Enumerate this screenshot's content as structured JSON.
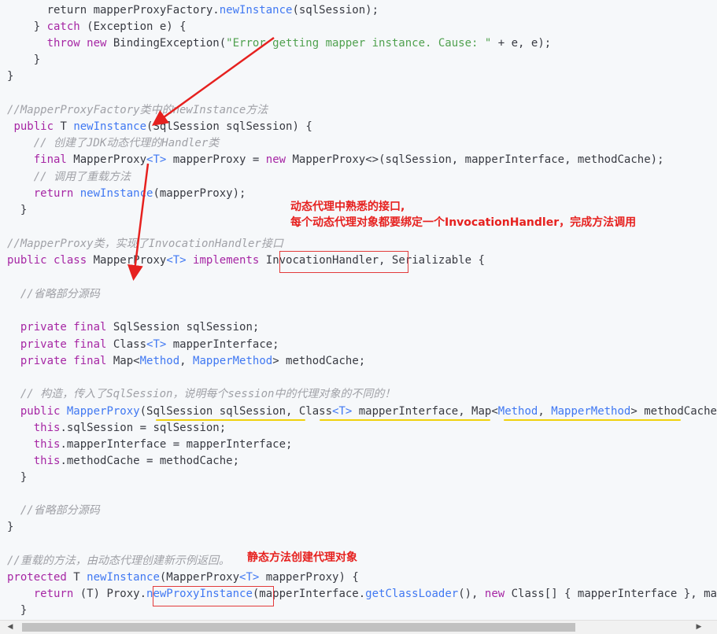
{
  "lines": [
    {
      "id": "l1",
      "segments": [
        [
          "plain",
          "      return mapperProxyFactory."
        ],
        [
          "fn",
          "newInstance"
        ],
        [
          "plain",
          "(sqlSession);"
        ]
      ]
    },
    {
      "id": "l2",
      "segments": [
        [
          "plain",
          "    } "
        ],
        [
          "kw",
          "catch"
        ],
        [
          "plain",
          " (Exception e) {"
        ]
      ]
    },
    {
      "id": "l3",
      "segments": [
        [
          "plain",
          "      "
        ],
        [
          "kw",
          "throw new"
        ],
        [
          "plain",
          " BindingException("
        ],
        [
          "str",
          "\"Error getting mapper instance. Cause: \""
        ],
        [
          "plain",
          " + e, e);"
        ]
      ]
    },
    {
      "id": "l4",
      "segments": [
        [
          "plain",
          "    }"
        ]
      ]
    },
    {
      "id": "l5",
      "segments": [
        [
          "plain",
          "}"
        ]
      ]
    },
    {
      "id": "l6",
      "segments": [
        [
          "plain",
          ""
        ]
      ]
    },
    {
      "id": "l7",
      "segments": [
        [
          "cm",
          "//MapperProxyFactory类中的newInstance方法"
        ]
      ]
    },
    {
      "id": "l8",
      "segments": [
        [
          "plain",
          " "
        ],
        [
          "kw",
          "public"
        ],
        [
          "plain",
          " T "
        ],
        [
          "fn",
          "newInstance"
        ],
        [
          "plain",
          "(SqlSession sqlSession) {"
        ]
      ]
    },
    {
      "id": "l9",
      "segments": [
        [
          "plain",
          "    "
        ],
        [
          "cm",
          "// 创建了JDK动态代理的Handler类"
        ]
      ]
    },
    {
      "id": "l10",
      "segments": [
        [
          "plain",
          "    "
        ],
        [
          "kw",
          "final"
        ],
        [
          "plain",
          " MapperProxy"
        ],
        [
          "ty",
          "<T>"
        ],
        [
          "plain",
          " mapperProxy = "
        ],
        [
          "kw",
          "new"
        ],
        [
          "plain",
          " MapperProxy<>(sqlSession, mapperInterface, methodCache);"
        ]
      ]
    },
    {
      "id": "l11",
      "segments": [
        [
          "plain",
          "    "
        ],
        [
          "cm",
          "// 调用了重载方法"
        ]
      ]
    },
    {
      "id": "l12",
      "segments": [
        [
          "plain",
          "    "
        ],
        [
          "kw",
          "return"
        ],
        [
          "plain",
          " "
        ],
        [
          "fn",
          "newInstance"
        ],
        [
          "plain",
          "(mapperProxy);"
        ]
      ]
    },
    {
      "id": "l13",
      "segments": [
        [
          "plain",
          "  }"
        ]
      ]
    },
    {
      "id": "l14",
      "segments": [
        [
          "plain",
          ""
        ]
      ]
    },
    {
      "id": "l15",
      "segments": [
        [
          "cm",
          "//MapperProxy类，实现了InvocationHandler接口"
        ]
      ]
    },
    {
      "id": "l16",
      "segments": [
        [
          "kw",
          "public class"
        ],
        [
          "plain",
          " MapperProxy"
        ],
        [
          "ty",
          "<T>"
        ],
        [
          "plain",
          " "
        ],
        [
          "kw",
          "implements"
        ],
        [
          "plain",
          " InvocationHandler, Serializable {"
        ]
      ]
    },
    {
      "id": "l17",
      "segments": [
        [
          "plain",
          ""
        ]
      ]
    },
    {
      "id": "l18",
      "segments": [
        [
          "plain",
          "  "
        ],
        [
          "cm",
          "//省略部分源码"
        ]
      ]
    },
    {
      "id": "l19",
      "segments": [
        [
          "plain",
          ""
        ]
      ]
    },
    {
      "id": "l20",
      "segments": [
        [
          "plain",
          "  "
        ],
        [
          "kw",
          "private final"
        ],
        [
          "plain",
          " SqlSession sqlSession;"
        ]
      ]
    },
    {
      "id": "l21",
      "segments": [
        [
          "plain",
          "  "
        ],
        [
          "kw",
          "private final"
        ],
        [
          "plain",
          " Class"
        ],
        [
          "ty",
          "<T>"
        ],
        [
          "plain",
          " mapperInterface;"
        ]
      ]
    },
    {
      "id": "l22",
      "segments": [
        [
          "plain",
          "  "
        ],
        [
          "kw",
          "private final"
        ],
        [
          "plain",
          " Map<"
        ],
        [
          "ty",
          "Method"
        ],
        [
          "plain",
          ", "
        ],
        [
          "ty",
          "MapperMethod"
        ],
        [
          "plain",
          "> methodCache;"
        ]
      ]
    },
    {
      "id": "l23",
      "segments": [
        [
          "plain",
          ""
        ]
      ]
    },
    {
      "id": "l24",
      "segments": [
        [
          "plain",
          "  "
        ],
        [
          "cm",
          "// 构造，传入了SqlSession，说明每个session中的代理对象的不同的！"
        ]
      ]
    },
    {
      "id": "l25",
      "segments": [
        [
          "plain",
          "  "
        ],
        [
          "kw",
          "public"
        ],
        [
          "plain",
          " "
        ],
        [
          "fn",
          "MapperProxy"
        ],
        [
          "plain",
          "(SqlSession sqlSession, Class"
        ],
        [
          "ty",
          "<T>"
        ],
        [
          "plain",
          " mapperInterface, Map<"
        ],
        [
          "ty",
          "Method"
        ],
        [
          "plain",
          ", "
        ],
        [
          "ty",
          "MapperMethod"
        ],
        [
          "plain",
          "> methodCache) {"
        ]
      ]
    },
    {
      "id": "l26",
      "segments": [
        [
          "plain",
          "    "
        ],
        [
          "kw",
          "this"
        ],
        [
          "plain",
          ".sqlSession = sqlSession;"
        ]
      ]
    },
    {
      "id": "l27",
      "segments": [
        [
          "plain",
          "    "
        ],
        [
          "kw",
          "this"
        ],
        [
          "plain",
          ".mapperInterface = mapperInterface;"
        ]
      ]
    },
    {
      "id": "l28",
      "segments": [
        [
          "plain",
          "    "
        ],
        [
          "kw",
          "this"
        ],
        [
          "plain",
          ".methodCache = methodCache;"
        ]
      ]
    },
    {
      "id": "l29",
      "segments": [
        [
          "plain",
          "  }"
        ]
      ]
    },
    {
      "id": "l30",
      "segments": [
        [
          "plain",
          ""
        ]
      ]
    },
    {
      "id": "l31",
      "segments": [
        [
          "plain",
          "  "
        ],
        [
          "cm",
          "//省略部分源码"
        ]
      ]
    },
    {
      "id": "l32",
      "segments": [
        [
          "plain",
          "}"
        ]
      ]
    },
    {
      "id": "l33",
      "segments": [
        [
          "plain",
          ""
        ]
      ]
    },
    {
      "id": "l34",
      "segments": [
        [
          "cm",
          "//重载的方法，由动态代理创建新示例返回。"
        ]
      ]
    },
    {
      "id": "l35",
      "segments": [
        [
          "kw",
          "protected"
        ],
        [
          "plain",
          " T "
        ],
        [
          "fn",
          "newInstance"
        ],
        [
          "plain",
          "(MapperProxy"
        ],
        [
          "ty",
          "<T>"
        ],
        [
          "plain",
          " mapperProxy) {"
        ]
      ]
    },
    {
      "id": "l36",
      "segments": [
        [
          "plain",
          "    "
        ],
        [
          "kw",
          "return"
        ],
        [
          "plain",
          " (T) Proxy."
        ],
        [
          "fn",
          "newProxyInstance"
        ],
        [
          "plain",
          "(mapperInterface."
        ],
        [
          "fn",
          "getClassLoader"
        ],
        [
          "plain",
          "(), "
        ],
        [
          "kw",
          "new"
        ],
        [
          "plain",
          " Class[] { mapperInterface }, mapperProxy);"
        ]
      ]
    },
    {
      "id": "l37",
      "segments": [
        [
          "plain",
          "  }"
        ]
      ]
    }
  ],
  "annotations": {
    "note1_line1": "动态代理中熟悉的接口,",
    "note1_line2": "每个动态代理对象都要绑定一个InvocationHandler，完成方法调用",
    "note2": "静态方法创建代理对象"
  },
  "colors": {
    "annotation": "#e6211f",
    "highlight_box": "#e33b3b",
    "underline": "#f0d10c"
  },
  "scrollbar": {
    "left_arrow": "◀",
    "right_arrow": "▶"
  }
}
